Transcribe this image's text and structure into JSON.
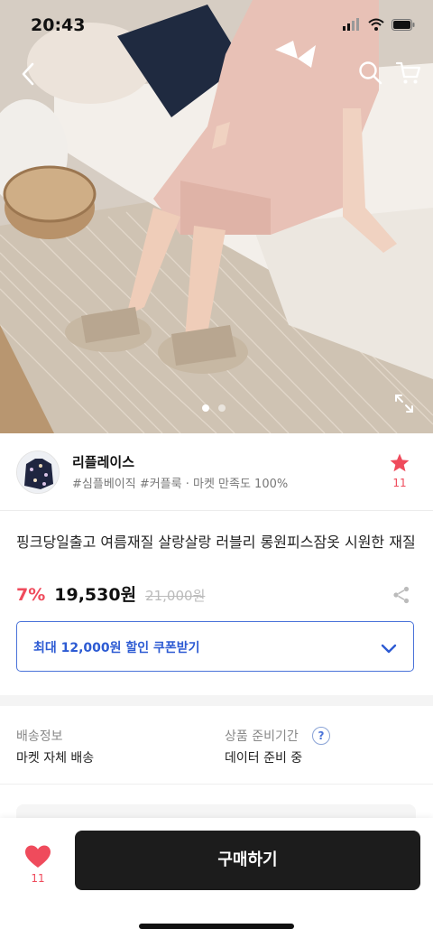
{
  "status_bar": {
    "time": "20:43"
  },
  "hero": {
    "slide_count": 2,
    "active_slide": 1
  },
  "seller": {
    "name": "리플레이스",
    "tags": "#심플베이직 #커플룩 · 마켓 만족도 100%",
    "favorite_count": "11"
  },
  "product": {
    "title": "핑크당일출고 여름재질 살랑살랑 러블리 롱원피스잠옷 시원한 재질",
    "discount": "7%",
    "price": "19,530원",
    "original_price": "21,000원"
  },
  "coupon": {
    "label": "최대 12,000원 할인 쿠폰받기"
  },
  "shipping": {
    "label": "배송정보",
    "value": "마켓 자체 배송",
    "prep_label": "상품 준비기간",
    "prep_value": "데이터 준비 중",
    "help_glyph": "?"
  },
  "bottom": {
    "like_count": "11",
    "buy_label": "구매하기"
  },
  "colors": {
    "accent_red": "#ef4b5c",
    "coupon_blue": "#2d5bd3",
    "buy_bg": "#1c1c1c"
  },
  "icons": [
    "back-icon",
    "search-icon",
    "cart-icon",
    "expand-icon",
    "star-icon",
    "share-icon",
    "chevron-down-icon",
    "heart-icon"
  ]
}
